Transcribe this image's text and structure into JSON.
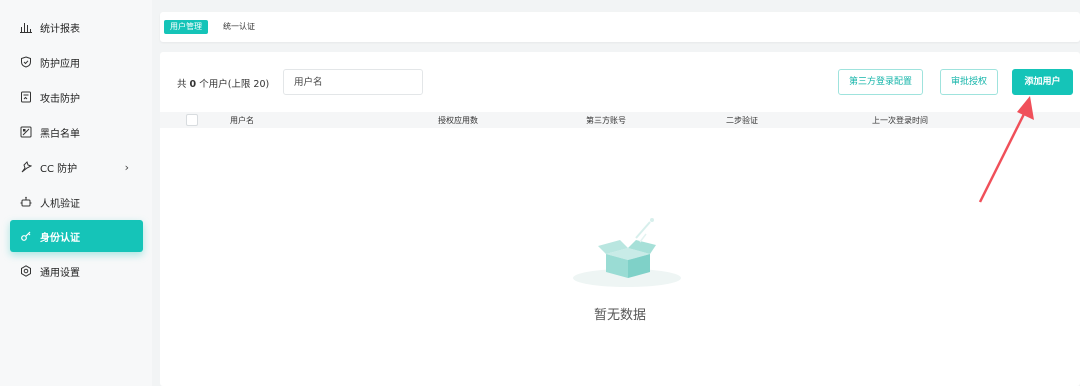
{
  "sidebar": {
    "items": [
      {
        "label": "统计报表",
        "icon": "bar-chart-icon",
        "active": false
      },
      {
        "label": "防护应用",
        "icon": "shield-icon",
        "active": false
      },
      {
        "label": "攻击防护",
        "icon": "attack-defense-icon",
        "active": false
      },
      {
        "label": "黑白名单",
        "icon": "blacklist-icon",
        "active": false
      },
      {
        "label": "CC 防护",
        "icon": "cc-protection-icon",
        "active": false,
        "chevron": "›"
      },
      {
        "label": "人机验证",
        "icon": "robot-icon",
        "active": false
      },
      {
        "label": "身份认证",
        "icon": "key-icon",
        "active": true
      },
      {
        "label": "通用设置",
        "icon": "gear-icon",
        "active": false
      }
    ]
  },
  "header": {
    "tabs": [
      {
        "label": "用户管理",
        "active": true
      },
      {
        "label": "统一认证",
        "active": false
      }
    ]
  },
  "toolbar": {
    "count_prefix": "共",
    "count_value": "0",
    "count_suffix": "个用户(上限 20)",
    "search_placeholder": "用户名",
    "buttons": {
      "third_party": "第三方登录配置",
      "approve": "审批授权",
      "add_user": "添加用户"
    }
  },
  "table": {
    "columns": [
      "用户名",
      "授权应用数",
      "第三方账号",
      "二步验证",
      "上一次登录时间"
    ]
  },
  "empty_state": {
    "text": "暂无数据"
  },
  "colors": {
    "accent": "#15c4b8",
    "annotation_arrow": "#f0505a"
  }
}
